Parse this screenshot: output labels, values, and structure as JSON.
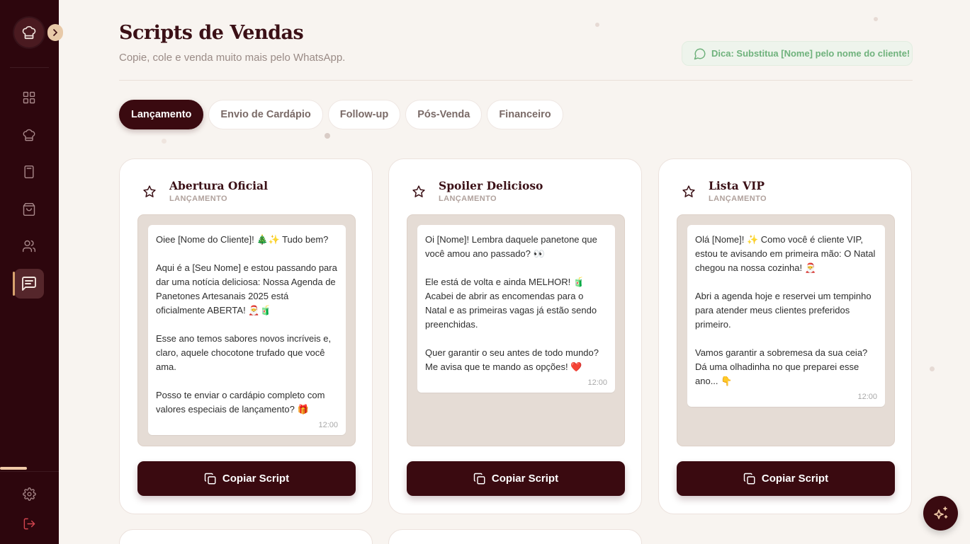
{
  "page": {
    "title": "Scripts de Vendas",
    "subtitle": "Copie, cole e venda muito mais pelo WhatsApp.",
    "tip": "Dica: Substitua [Nome] pelo nome do cliente!"
  },
  "tabs": [
    {
      "label": "Lançamento",
      "active": true
    },
    {
      "label": "Envio de Cardápio",
      "active": false
    },
    {
      "label": "Follow-up",
      "active": false
    },
    {
      "label": "Pós-Venda",
      "active": false
    },
    {
      "label": "Financeiro",
      "active": false
    }
  ],
  "cards": [
    {
      "title": "Abertura Oficial",
      "category": "LANÇAMENTO",
      "paragraphs": [
        "Oiee [Nome do Cliente]! 🎄✨ Tudo bem?",
        "Aqui é a [Seu Nome] e estou passando para dar uma notícia deliciosa: Nossa Agenda de Panetones Artesanais 2025 está oficialmente ABERTA! 🎅🧃",
        "Esse ano temos sabores novos incríveis e, claro, aquele chocotone trufado que você ama.",
        "Posso te enviar o cardápio completo com valores especiais de lançamento? 🎁"
      ],
      "time": "12:00",
      "button": "Copiar Script"
    },
    {
      "title": "Spoiler Delicioso",
      "category": "LANÇAMENTO",
      "paragraphs": [
        "Oi [Nome]! Lembra daquele panetone que você amou ano passado? 👀",
        "Ele está de volta e ainda MELHOR! 🧃 Acabei de abrir as encomendas para o Natal e as primeiras vagas já estão sendo preenchidas.",
        "Quer garantir o seu antes de todo mundo? Me avisa que te mando as opções! ❤️"
      ],
      "time": "12:00",
      "button": "Copiar Script"
    },
    {
      "title": "Lista VIP",
      "category": "LANÇAMENTO",
      "paragraphs": [
        "Olá [Nome]! ✨ Como você é cliente VIP, estou te avisando em primeira mão: O Natal chegou na nossa cozinha! 🎅",
        "Abri a agenda hoje e reservei um tempinho para atender meus clientes preferidos primeiro.",
        "Vamos garantir a sobremesa da sua ceia? Dá uma olhadinha no que preparei esse ano... 👇"
      ],
      "time": "12:00",
      "button": "Copiar Script"
    }
  ],
  "icons": {
    "logo": "chef-hat-icon",
    "collapse": "chevron-right-icon",
    "nav": [
      "dashboard-icon",
      "chef-hat-icon",
      "calculator-icon",
      "shopping-bag-icon",
      "users-icon",
      "message-square-text-icon"
    ],
    "settings": "gear-icon",
    "logout": "logout-icon",
    "tip": "message-circle-icon",
    "favorite": "star-icon",
    "copy": "copy-icon",
    "fab": "sparkles-icon"
  },
  "colors": {
    "sidebar": "#2d060d",
    "primary": "#3a0a10",
    "accent": "#e8c9a8",
    "tip_text": "#6fb27c",
    "chat_bg": "#e5dcd5"
  }
}
